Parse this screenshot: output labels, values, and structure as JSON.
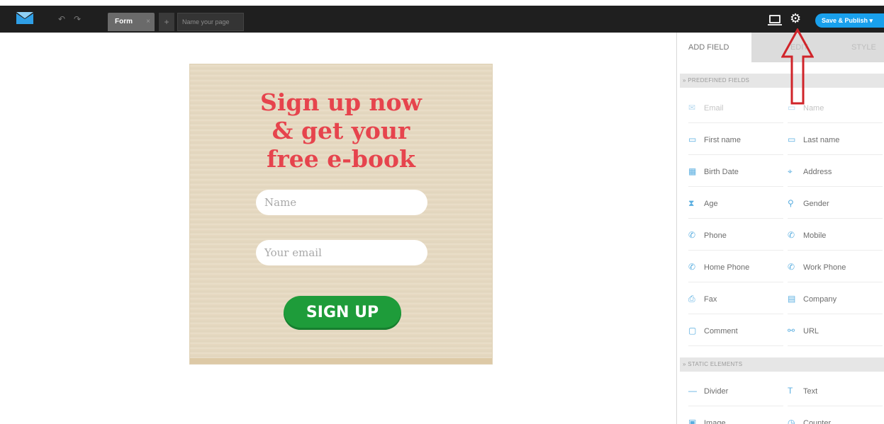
{
  "toolbar": {
    "undo_glyph": "↶",
    "redo_glyph": "↷",
    "tab_form_label": "Form",
    "tab_close_glyph": "×",
    "tab_add_glyph": "+",
    "page_name_placeholder": "Name your page",
    "gear_glyph": "⚙",
    "save_label": "Save & Publish ▾",
    "accent_color": "#19a0ec"
  },
  "form": {
    "headline": [
      "Sign up now",
      "& get your",
      "free e-book"
    ],
    "name_placeholder": "Name",
    "email_placeholder": "Your email",
    "submit_label": "SIGN UP",
    "headline_color": "#e6444d",
    "button_color": "#1e9c3a"
  },
  "panel": {
    "tabs": [
      {
        "label": "ADD FIELD"
      },
      {
        "label": "EDIT"
      },
      {
        "label": "STYLE"
      }
    ],
    "predefined_header": "» PREDEFINED FIELDS",
    "predefined_fields": [
      {
        "label": "Email",
        "icon": "email-icon",
        "glyph": "✉",
        "faded": true
      },
      {
        "label": "Name",
        "icon": "name-icon",
        "glyph": "▭",
        "faded": true
      },
      {
        "label": "First name",
        "icon": "first-name-icon",
        "glyph": "▭"
      },
      {
        "label": "Last name",
        "icon": "last-name-icon",
        "glyph": "▭"
      },
      {
        "label": "Birth Date",
        "icon": "calendar-icon",
        "glyph": "▦"
      },
      {
        "label": "Address",
        "icon": "location-pin-icon",
        "glyph": "⌖"
      },
      {
        "label": "Age",
        "icon": "hourglass-icon",
        "glyph": "⧗"
      },
      {
        "label": "Gender",
        "icon": "gender-icon",
        "glyph": "⚲"
      },
      {
        "label": "Phone",
        "icon": "phone-icon",
        "glyph": "✆"
      },
      {
        "label": "Mobile",
        "icon": "mobile-icon",
        "glyph": "✆"
      },
      {
        "label": "Home Phone",
        "icon": "home-phone-icon",
        "glyph": "✆"
      },
      {
        "label": "Work Phone",
        "icon": "work-phone-icon",
        "glyph": "✆"
      },
      {
        "label": "Fax",
        "icon": "fax-icon",
        "glyph": "⎙"
      },
      {
        "label": "Company",
        "icon": "company-icon",
        "glyph": "▤"
      },
      {
        "label": "Comment",
        "icon": "comment-icon",
        "glyph": "▢"
      },
      {
        "label": "URL",
        "icon": "link-icon",
        "glyph": "⚯"
      }
    ],
    "static_header": "» STATIC ELEMENTS",
    "static_fields": [
      {
        "label": "Divider",
        "icon": "divider-icon",
        "glyph": "—"
      },
      {
        "label": "Text",
        "icon": "text-icon",
        "glyph": "T"
      },
      {
        "label": "Image",
        "icon": "image-icon",
        "glyph": "▣"
      },
      {
        "label": "Counter",
        "icon": "counter-icon",
        "glyph": "◷"
      }
    ]
  },
  "annotation": {
    "arrow_color": "#d0242a"
  }
}
